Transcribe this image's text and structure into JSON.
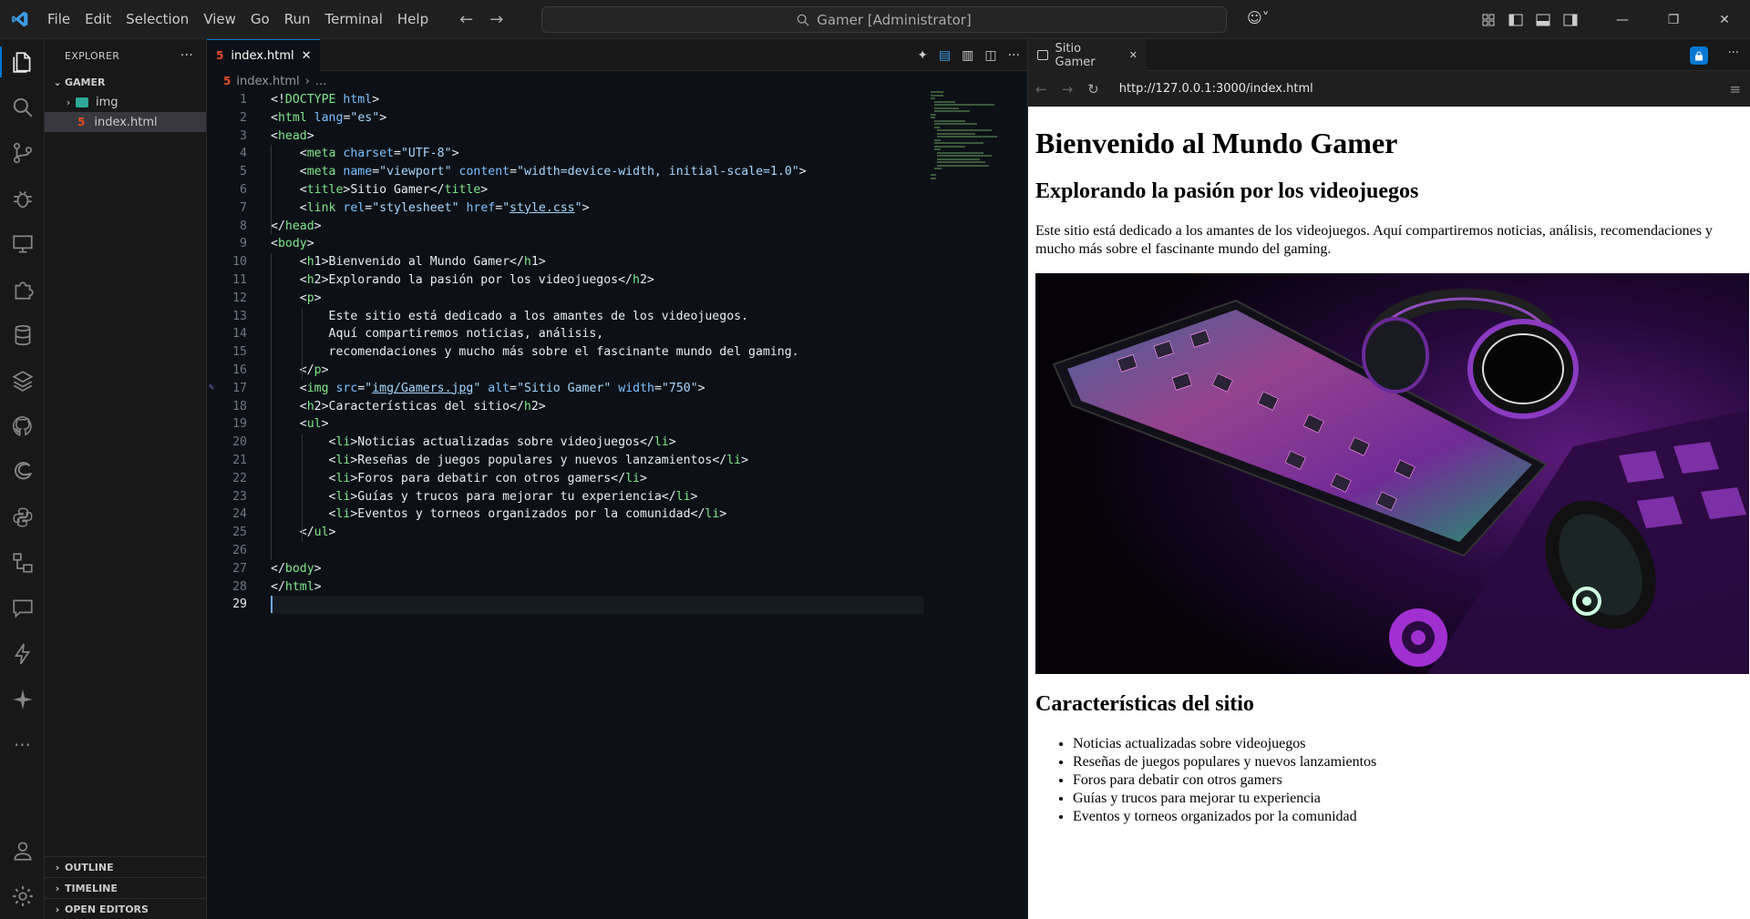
{
  "titlebar": {
    "menu": [
      "File",
      "Edit",
      "Selection",
      "View",
      "Go",
      "Run",
      "Terminal",
      "Help"
    ],
    "search_text": "Gamer [Administrator]"
  },
  "sidebar": {
    "header": "EXPLORER",
    "folder": "GAMER",
    "items": [
      {
        "label": "img",
        "type": "folder"
      },
      {
        "label": "index.html",
        "type": "file"
      }
    ],
    "sections": [
      "OUTLINE",
      "TIMELINE",
      "OPEN EDITORS"
    ]
  },
  "editor": {
    "tab_label": "index.html",
    "breadcrumb_file": "index.html",
    "breadcrumb_more": "...",
    "current_line": 29,
    "lines": [
      "<!DOCTYPE html>",
      "<html lang=\"es\">",
      "<head>",
      "    <meta charset=\"UTF-8\">",
      "    <meta name=\"viewport\" content=\"width=device-width, initial-scale=1.0\">",
      "    <title>Sitio Gamer</title>",
      "    <link rel=\"stylesheet\" href=\"style.css\">",
      "</head>",
      "<body>",
      "    <h1>Bienvenido al Mundo Gamer</h1>",
      "    <h2>Explorando la pasión por los videojuegos</h2>",
      "    <p>",
      "        Este sitio está dedicado a los amantes de los videojuegos.",
      "        Aquí compartiremos noticias, análisis,",
      "        recomendaciones y mucho más sobre el fascinante mundo del gaming.",
      "    </p>",
      "    <img src=\"img/Gamers.jpg\" alt=\"Sitio Gamer\" width=\"750\">",
      "    <h2>Características del sitio</h2>",
      "    <ul>",
      "        <li>Noticias actualizadas sobre videojuegos</li>",
      "        <li>Reseñas de juegos populares y nuevos lanzamientos</li>",
      "        <li>Foros para debatir con otros gamers</li>",
      "        <li>Guías y trucos para mejorar tu experiencia</li>",
      "        <li>Eventos y torneos organizados por la comunidad</li>",
      "    </ul>",
      "",
      "</body>",
      "</html>",
      ""
    ]
  },
  "preview": {
    "tab_label": "Sitio Gamer",
    "url": "http://127.0.0.1:3000/index.html",
    "h1": "Bienvenido al Mundo Gamer",
    "h2_intro": "Explorando la pasión por los videojuegos",
    "paragraph": "Este sitio está dedicado a los amantes de los videojuegos. Aquí compartiremos noticias, análisis, recomendaciones y mucho más sobre el fascinante mundo del gaming.",
    "image_alt": "Sitio Gamer",
    "h2_features": "Características del sitio",
    "features": [
      "Noticias actualizadas sobre videojuegos",
      "Reseñas de juegos populares y nuevos lanzamientos",
      "Foros para debatir con otros gamers",
      "Guías y trucos para mejorar tu experiencia",
      "Eventos y torneos organizados por la comunidad"
    ]
  },
  "colors": {
    "accent": "#0078d4",
    "tag": "#7ee787",
    "attr": "#79c0ff",
    "string": "#a5d6ff",
    "html_icon": "#e44d26"
  }
}
